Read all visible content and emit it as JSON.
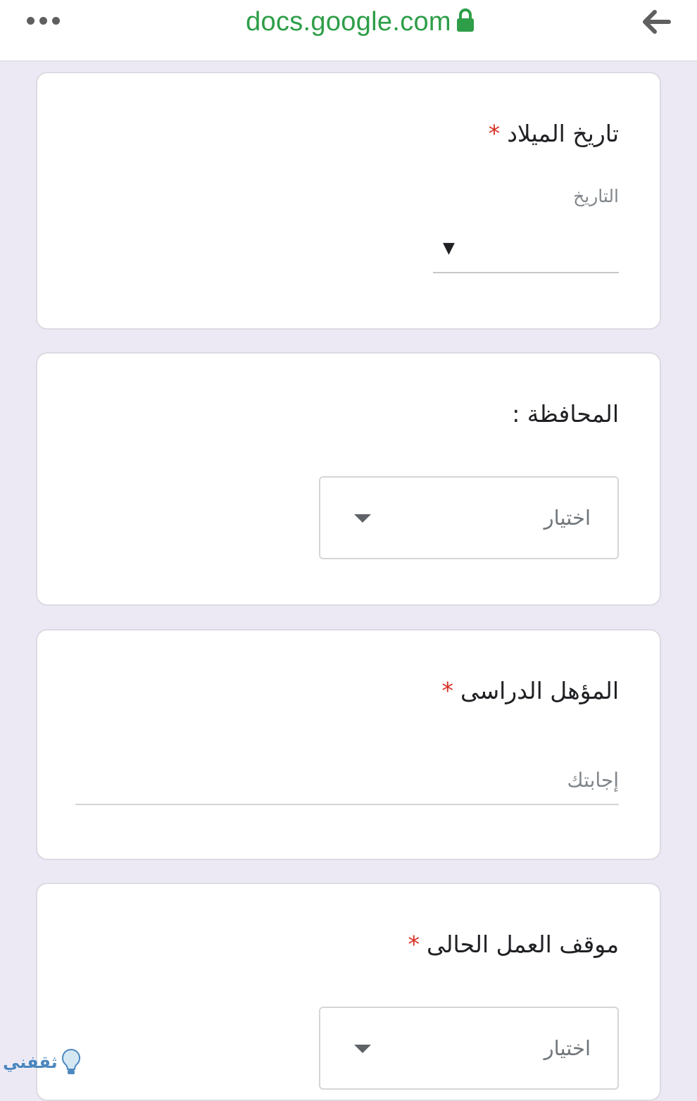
{
  "browser": {
    "url": "docs.google.com",
    "menu_icon": "more-dots-icon",
    "lock_icon": "lock-icon",
    "back_icon": "back-arrow-icon",
    "url_color": "#2e9e48"
  },
  "form": {
    "birthdate": {
      "title": "تاريخ الميلاد",
      "required_mark": "*",
      "date_label": "التاريخ",
      "caret": "▼"
    },
    "governorate": {
      "title": "المحافظة :",
      "select_placeholder": "اختيار"
    },
    "qualification": {
      "title": "المؤهل الدراسى",
      "required_mark": "*",
      "answer_placeholder": "إجابتك"
    },
    "work_status": {
      "title": "موقف العمل الحالى",
      "required_mark": "*",
      "select_placeholder": "اختيار"
    }
  },
  "watermark": {
    "text": "ثقفني",
    "icon": "lightbulb-icon"
  },
  "colors": {
    "page_background": "#ece9f5",
    "required": "#d93025",
    "card_border": "#dcdae2"
  }
}
